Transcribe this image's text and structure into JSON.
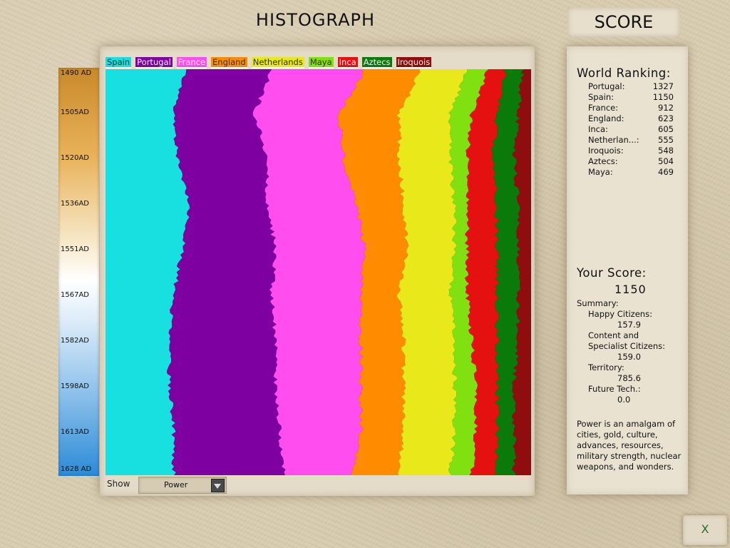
{
  "header": {
    "title": "HISTOGRAPH",
    "score_title": "SCORE"
  },
  "legend": [
    {
      "name": "Spain",
      "color": "#19e0e0"
    },
    {
      "name": "Portugal",
      "color": "#7f00a0"
    },
    {
      "name": "France",
      "color": "#ff4df0"
    },
    {
      "name": "England",
      "color": "#ff8c00"
    },
    {
      "name": "Netherlands",
      "color": "#e8e81a"
    },
    {
      "name": "Maya",
      "color": "#80e010"
    },
    {
      "name": "Inca",
      "color": "#e51010"
    },
    {
      "name": "Aztecs",
      "color": "#0a7a0a"
    },
    {
      "name": "Iroquois",
      "color": "#8e0e0e"
    }
  ],
  "timeline": [
    "1490 AD",
    "1505AD",
    "1520AD",
    "1536AD",
    "1551AD",
    "1567AD",
    "1582AD",
    "1598AD",
    "1613AD",
    "1628 AD"
  ],
  "controls": {
    "show_label": "Show",
    "show_value": "Power"
  },
  "chart_data": {
    "type": "area",
    "stacking": "percent",
    "orientation": "vertical-time",
    "categories": [
      "1490 AD",
      "1505AD",
      "1520AD",
      "1536AD",
      "1551AD",
      "1567AD",
      "1582AD",
      "1598AD",
      "1613AD",
      "1628 AD"
    ],
    "series": [
      {
        "name": "Spain",
        "color": "#19e0e0",
        "values": [
          19,
          16,
          17,
          20,
          18,
          16,
          15,
          15,
          16,
          16
        ]
      },
      {
        "name": "Portugal",
        "color": "#7f00a0",
        "values": [
          20,
          19,
          21,
          18,
          22,
          23,
          25,
          25,
          25,
          26
        ]
      },
      {
        "name": "France",
        "color": "#ff4df0",
        "values": [
          22,
          20,
          18,
          21,
          21,
          21,
          20,
          20,
          19,
          16
        ]
      },
      {
        "name": "England",
        "color": "#ff8c00",
        "values": [
          13,
          14,
          13,
          11,
          10,
          9,
          10,
          10,
          10,
          11
        ]
      },
      {
        "name": "Netherlands",
        "color": "#e8e81a",
        "values": [
          11,
          12,
          12,
          12,
          11,
          12,
          12,
          12,
          12,
          12
        ]
      },
      {
        "name": "Maya",
        "color": "#80e010",
        "values": [
          5,
          5,
          4,
          3,
          3,
          4,
          4,
          5,
          5,
          5
        ]
      },
      {
        "name": "Inca",
        "color": "#e51010",
        "values": [
          4,
          6,
          6,
          7,
          7,
          7,
          6,
          5,
          5,
          6
        ]
      },
      {
        "name": "Aztecs",
        "color": "#0a7a0a",
        "values": [
          4,
          5,
          5,
          5,
          5,
          5,
          5,
          4,
          4,
          4
        ]
      },
      {
        "name": "Iroquois",
        "color": "#8e0e0e",
        "values": [
          2,
          3,
          4,
          3,
          3,
          3,
          3,
          4,
          4,
          4
        ]
      }
    ]
  },
  "score_panel": {
    "ranking_title": "World Ranking:",
    "ranking": [
      {
        "name": "Portugal:",
        "value": "1327"
      },
      {
        "name": "Spain:",
        "value": "1150"
      },
      {
        "name": "France:",
        "value": "912"
      },
      {
        "name": "England:",
        "value": "623"
      },
      {
        "name": "Inca:",
        "value": "605"
      },
      {
        "name": "Netherlan...:",
        "value": "555"
      },
      {
        "name": "Iroquois:",
        "value": "548"
      },
      {
        "name": "Aztecs:",
        "value": "504"
      },
      {
        "name": "Maya:",
        "value": "469"
      }
    ],
    "your_score_title": "Your Score:",
    "your_score": "1150",
    "summary_title": "Summary:",
    "happy_label": "Happy Citizens:",
    "happy_value": "157.9",
    "content_label_1": "Content and",
    "content_label_2": "Specialist Citizens:",
    "content_value": "159.0",
    "territory_label": "Territory:",
    "territory_value": "785.6",
    "future_label": "Future Tech.:",
    "future_value": "0.0",
    "description": "Power is an amalgam of cities, gold, culture, advances, resources, military strength, nuclear weapons, and wonders."
  },
  "close_button": {
    "label": "X"
  }
}
